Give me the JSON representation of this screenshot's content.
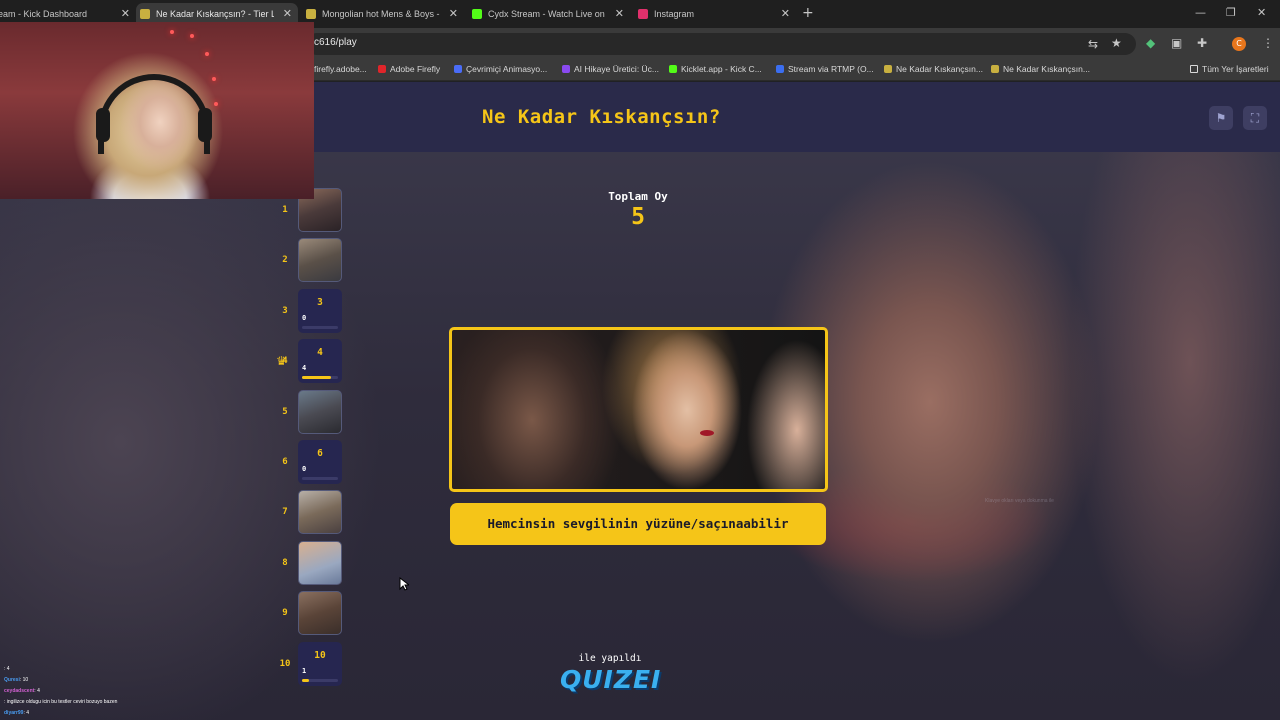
{
  "browser": {
    "tabs": [
      {
        "label": "eam - Kick Dashboard",
        "active": false,
        "favicon_color": "#53fc18"
      },
      {
        "label": "Ne Kadar Kıskançsın? - Tier List",
        "active": true,
        "favicon_color": "#f5c518"
      },
      {
        "label": "Mongolian hot Mens & Boys - Y",
        "active": false,
        "favicon_color": "#c8b040"
      },
      {
        "label": "Cydx Stream - Watch Live on Ki",
        "active": false,
        "favicon_color": "#53fc18"
      },
      {
        "label": "Instagram",
        "active": false,
        "favicon_color": "#e1306c"
      }
    ],
    "new_tab": "+",
    "window_controls": {
      "minimize": "—",
      "maximize": "❐",
      "close": "✕"
    },
    "url": "c616/play",
    "profile_initial": "C",
    "bookmarks": [
      {
        "label": "firefly.adobe...",
        "favicon_color": "#777777"
      },
      {
        "label": "Adobe Firefly",
        "favicon_color": "#e0252a"
      },
      {
        "label": "Çevrimiçi Animasyo...",
        "favicon_color": "#4a6cf7"
      },
      {
        "label": "AI Hikaye Üretici: Üc...",
        "favicon_color": "#8a4af0"
      },
      {
        "label": "Kicklet.app - Kick C...",
        "favicon_color": "#53fc18"
      },
      {
        "label": "Stream via RTMP (O...",
        "favicon_color": "#3b6ef0"
      },
      {
        "label": "Ne Kadar Kıskançsın...",
        "favicon_color": "#c8b040"
      },
      {
        "label": "Ne Kadar Kıskançsın...",
        "favicon_color": "#c8b040"
      }
    ],
    "all_bookmarks": "Tüm Yer İşaretleri"
  },
  "quiz": {
    "title": "Ne Kadar Kıskançsın?",
    "total_votes_label": "Toplam Oy",
    "total_votes_value": "5",
    "answer_text": "Hemcinsin sevgilinin yüzüne/saçınaabilir",
    "made_with": "ile yapıldı",
    "brand": "QUIZEI",
    "faint_overlay_text": "Klavye okları veya dokunma ile"
  },
  "tiers": [
    {
      "rank": "1",
      "kind": "image",
      "count": null,
      "fill": null
    },
    {
      "rank": "2",
      "kind": "image",
      "count": null,
      "fill": null
    },
    {
      "rank": "3",
      "kind": "empty",
      "count": "0",
      "fill": 0.0
    },
    {
      "rank": "4",
      "kind": "empty",
      "count": "4",
      "fill": 0.8,
      "crowned": true
    },
    {
      "rank": "5",
      "kind": "image",
      "count": null,
      "fill": null
    },
    {
      "rank": "6",
      "kind": "empty",
      "count": "0",
      "fill": 0.0
    },
    {
      "rank": "7",
      "kind": "image",
      "count": null,
      "fill": null
    },
    {
      "rank": "8",
      "kind": "image",
      "count": null,
      "fill": null
    },
    {
      "rank": "9",
      "kind": "image",
      "count": null,
      "fill": null
    },
    {
      "rank": "10",
      "kind": "empty",
      "count": "1",
      "fill": 0.2
    }
  ],
  "chat": [
    {
      "user": "",
      "text": ": 4",
      "color": "#d04060"
    },
    {
      "user": "Quresi",
      "text": ": 10",
      "color": "#4a9cf0"
    },
    {
      "user": "ceydadscent",
      "text": ": 4",
      "color": "#d060d0"
    },
    {
      "user": "",
      "text": ": ingilizce oldugu icin bu testler ceviri bozuyo bazen",
      "color": "#d04060"
    },
    {
      "user": "diyarr99",
      "text": ": 4",
      "color": "#4a9cf0"
    }
  ]
}
